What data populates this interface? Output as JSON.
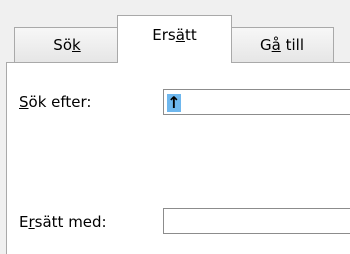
{
  "tabs": [
    {
      "pre": "Sö",
      "ul": "k",
      "post": ""
    },
    {
      "pre": "Ers",
      "ul": "ä",
      "post": "tt"
    },
    {
      "pre": "G",
      "ul": "å",
      "post": " till"
    }
  ],
  "find": {
    "label_ul": "S",
    "label_rest": "ök efter:",
    "value": "↑"
  },
  "replace": {
    "label_pre": "E",
    "label_ul": "r",
    "label_rest": "sätt med:",
    "value": ""
  },
  "colors": {
    "selection": "#6eb7ee",
    "border": "#a9a9a9",
    "background": "#f0f0f0"
  }
}
